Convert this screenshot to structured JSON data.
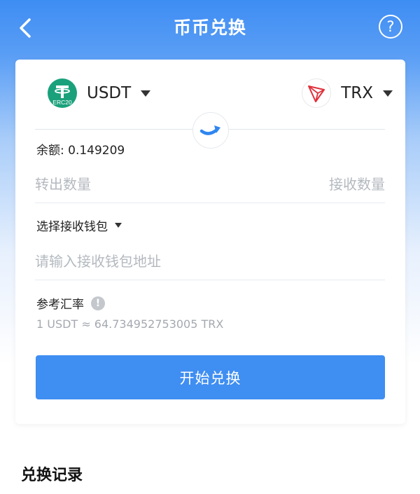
{
  "header": {
    "title": "币币兑换",
    "help_label": "?"
  },
  "exchange": {
    "from_coin": {
      "name": "USDT",
      "icon": "tether-erc20-icon",
      "icon_badge": "ERC20"
    },
    "to_coin": {
      "name": "TRX",
      "icon": "tron-icon"
    },
    "balance_label": "余额: 0.149209",
    "amount_out_placeholder": "转出数量",
    "amount_in_placeholder": "接收数量",
    "wallet_select_label": "选择接收钱包",
    "address_placeholder": "请输入接收钱包地址",
    "rate_label": "参考汇率",
    "rate_value": "1 USDT ≈ 64.734952753005 TRX",
    "start_button": "开始兑换"
  },
  "history": {
    "title": "兑换记录"
  },
  "colors": {
    "primary": "#3f8ef2",
    "usdt_green": "#1aa17b",
    "tron_red": "#e0303a"
  }
}
